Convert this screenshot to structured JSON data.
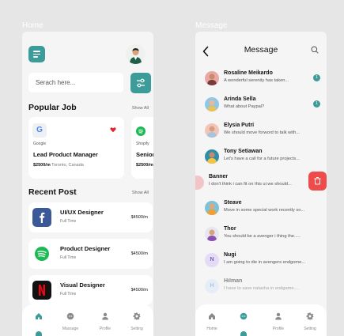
{
  "home": {
    "screen_label": "Home",
    "search_placeholder": "Serach here...",
    "popular_title": "Popular Job",
    "popular_show_all": "Show All",
    "jobs": [
      {
        "company": "Google",
        "title": "Lead Product Manager",
        "salary": "$2500/m",
        "location": "Toronto, Canada"
      },
      {
        "company": "Shopify",
        "title": "Senior U",
        "salary": "$2500/m",
        "location": ""
      }
    ],
    "recent_title": "Recent Post",
    "recent_show_all": "Show All",
    "posts": [
      {
        "title": "UI/UX Designer",
        "type": "Full Time",
        "price": "$4500/m",
        "logo": "facebook-icon"
      },
      {
        "title": "Product Designer",
        "type": "Full Time",
        "price": "$4500/m",
        "logo": "spotify-icon"
      },
      {
        "title": "Visual Designer",
        "type": "Full Time",
        "price": "$4500/m",
        "logo": "netflix-icon"
      }
    ],
    "nav": [
      {
        "label": "",
        "icon": "home-icon",
        "active": true
      },
      {
        "label": "Massage",
        "icon": "chat-icon"
      },
      {
        "label": "Profile",
        "icon": "user-icon"
      },
      {
        "label": "Setting",
        "icon": "gear-icon"
      }
    ]
  },
  "message": {
    "screen_label": "Message",
    "header_title": "Message",
    "conversations": [
      {
        "name": "Rosaline Meikardo",
        "text": "A wonderful serenity has taken...",
        "unread": "1",
        "avatar": "pink"
      },
      {
        "name": "Arinda Sella",
        "text": "What about Paypal?",
        "unread": "1",
        "avatar": "blue"
      },
      {
        "name": "Elysia Putri",
        "text": "We should move forword to talk with...",
        "unread": "",
        "avatar": "peach"
      },
      {
        "name": "Tony Setiawan",
        "text": "Let's have a call for a future projects...",
        "unread": "",
        "avatar": "teal"
      }
    ],
    "swiped": {
      "name": "Banner",
      "text": "I don't think i can fit on this ui we should..."
    },
    "conversations_lower": [
      {
        "name": "Steave",
        "text": "Move in some special work recently so...",
        "initial": "",
        "avatar": "orange"
      },
      {
        "name": "Thor",
        "text": "You should be a avenger i thing the.....",
        "initial": "",
        "avatar": "purple"
      },
      {
        "name": "Nugi",
        "text": "I am going to die in avengers endgome...",
        "initial": "N",
        "avatar": "lavender"
      },
      {
        "name": "Hilman",
        "text": "I have to save natasha in endgame....",
        "initial": "H",
        "avatar": "lightblue"
      }
    ],
    "nav": [
      {
        "label": "Home",
        "icon": "home-icon"
      },
      {
        "label": "",
        "icon": "chat-icon",
        "active": true
      },
      {
        "label": "Profile",
        "icon": "user-icon"
      },
      {
        "label": "Setting",
        "icon": "gear-icon"
      }
    ]
  },
  "colors": {
    "accent": "#3d9c99",
    "delete": "#ee4b4b",
    "background": "#e6e6e6",
    "card": "#ffffff"
  }
}
